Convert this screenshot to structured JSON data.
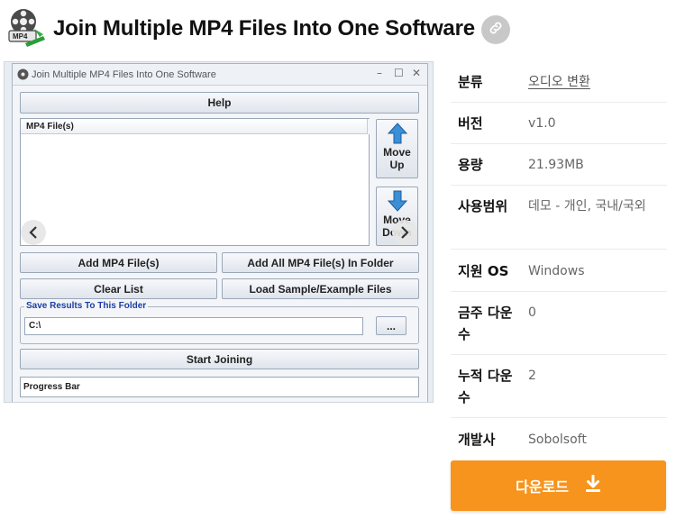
{
  "header": {
    "title": "Join Multiple MP4 Files Into One Software",
    "logo_text": "MP4"
  },
  "screenshot": {
    "window_title": "Join Multiple MP4 Files Into One Software",
    "help_label": "Help",
    "list_header": "MP4 File(s)",
    "move_up_line1": "Move",
    "move_up_line2": "Up",
    "move_down_line1": "Move",
    "move_down_line2": "Down",
    "add_files_label": "Add MP4 File(s)",
    "add_folder_label": "Add All MP4 File(s) In Folder",
    "clear_list_label": "Clear List",
    "load_sample_label": "Load Sample/Example Files",
    "save_group_label": "Save Results To This Folder",
    "save_path": "C:\\",
    "browse_label": "...",
    "start_label": "Start Joining",
    "progress_label": "Progress Bar"
  },
  "info": {
    "rows": [
      {
        "label": "분류",
        "value": "오디오 변환"
      },
      {
        "label": "버전",
        "value": "v1.0"
      },
      {
        "label": "용량",
        "value": "21.93MB"
      },
      {
        "label": "사용범위",
        "value": "데모 - 개인, 국내/국외"
      },
      {
        "label": "지원 OS",
        "value": "Windows"
      },
      {
        "label": "금주 다운수",
        "value": "0"
      },
      {
        "label": "누적 다운수",
        "value": "2"
      },
      {
        "label": "개발사",
        "value": "Sobolsoft"
      }
    ]
  },
  "download": {
    "label": "다운로드"
  },
  "colors": {
    "accent": "#f7941d",
    "link_button": "#c8c8c8",
    "group_legend": "#1a3fa3"
  },
  "icons": [
    "film-reel-icon",
    "link-icon",
    "arrow-up-icon",
    "arrow-down-icon",
    "chevron-left-icon",
    "chevron-right-icon",
    "download-icon"
  ]
}
